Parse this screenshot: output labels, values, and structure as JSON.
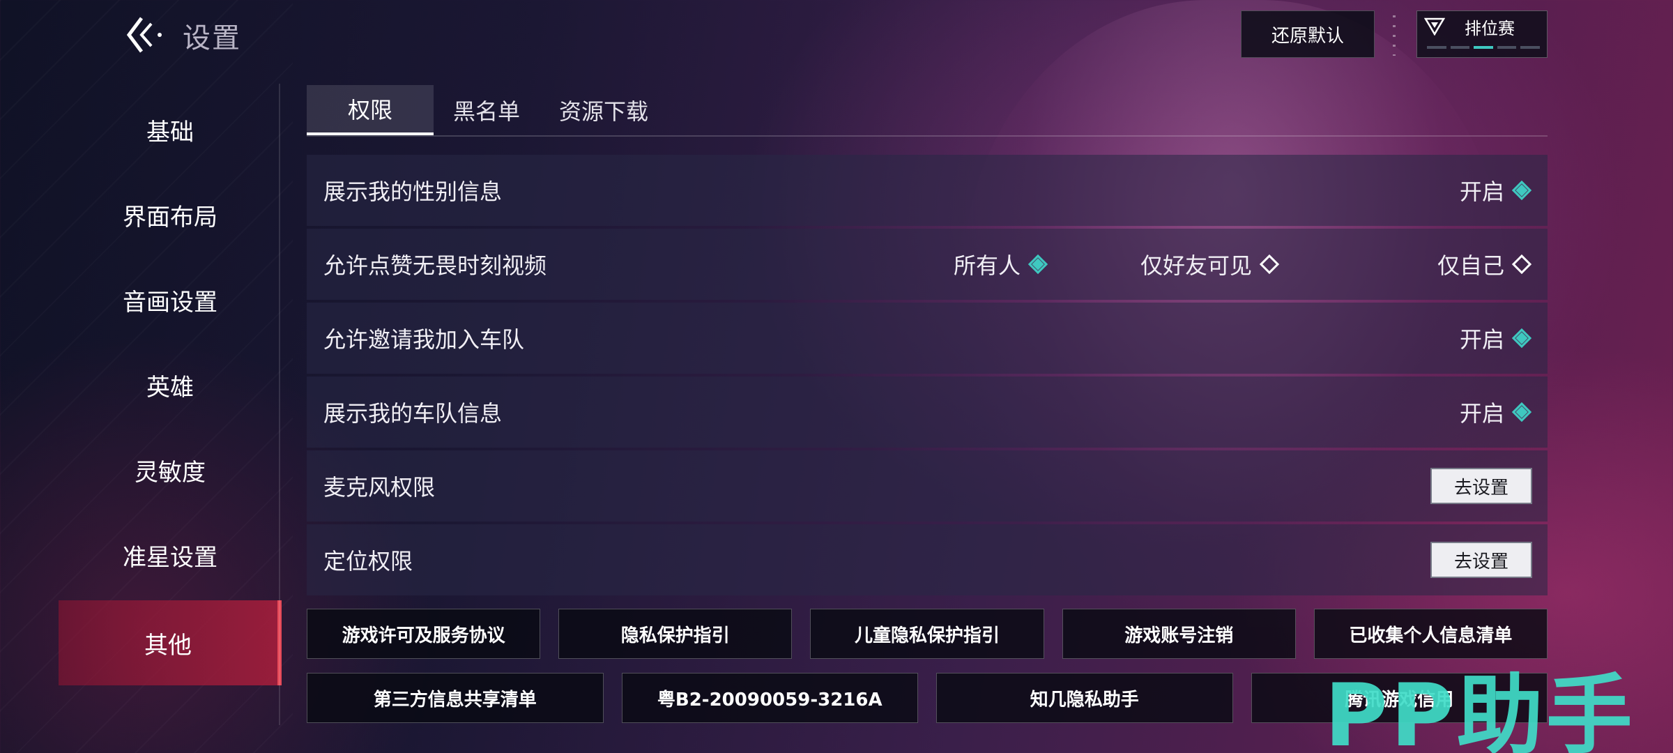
{
  "header": {
    "title": "设置",
    "reset_label": "还原默认",
    "mode_label": "排位赛",
    "mode_progress_step": 3,
    "mode_progress_total": 5
  },
  "sidebar": {
    "items": [
      {
        "label": "基础"
      },
      {
        "label": "界面布局"
      },
      {
        "label": "音画设置"
      },
      {
        "label": "英雄"
      },
      {
        "label": "灵敏度"
      },
      {
        "label": "准星设置"
      },
      {
        "label": "其他",
        "active": true
      }
    ]
  },
  "tabs": [
    {
      "label": "权限",
      "active": true
    },
    {
      "label": "黑名单"
    },
    {
      "label": "资源下载"
    }
  ],
  "settings": {
    "gender": {
      "label": "展示我的性别信息",
      "value": "开启"
    },
    "likes": {
      "label": "允许点赞无畏时刻视频",
      "options": [
        "所有人",
        "仅好友可见",
        "仅自己"
      ],
      "selected": "所有人"
    },
    "invite": {
      "label": "允许邀请我加入车队",
      "value": "开启"
    },
    "team_info": {
      "label": "展示我的车队信息",
      "value": "开启"
    },
    "mic": {
      "label": "麦克风权限",
      "button": "去设置"
    },
    "location": {
      "label": "定位权限",
      "button": "去设置"
    }
  },
  "links": {
    "row1": [
      "游戏许可及服务协议",
      "隐私保护指引",
      "儿童隐私保护指引",
      "游戏账号注销",
      "已收集个人信息清单"
    ],
    "row2": [
      "第三方信息共享清单",
      "粤B2-20090059-3216A",
      "知几隐私助手",
      "腾讯游戏信用"
    ]
  },
  "watermark": "PP助手",
  "colors": {
    "accent": "#3fc8c0",
    "active_sidebar": "#e64857"
  }
}
